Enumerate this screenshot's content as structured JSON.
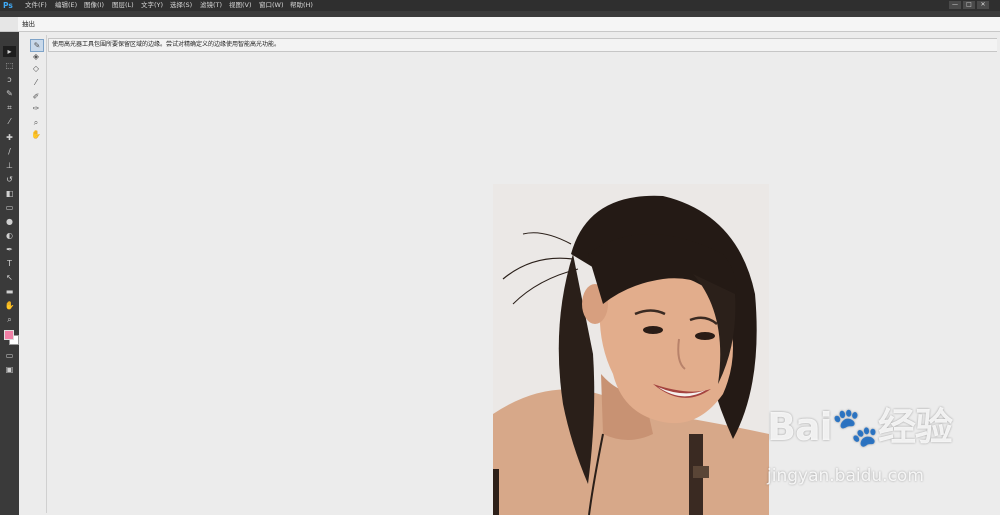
{
  "app": {
    "logo": "Ps"
  },
  "menu": [
    "文件(F)",
    "编辑(E)",
    "图像(I)",
    "图层(L)",
    "文字(Y)",
    "选择(S)",
    "滤镜(T)",
    "视图(V)",
    "窗口(W)",
    "帮助(H)"
  ],
  "window_controls": [
    "—",
    "□",
    "✕"
  ],
  "dialog": {
    "title": "抽出",
    "instruction": "使用高光器工具包围所要保留区域的边缘。尝试对精确定义的边缘使用智能高光功能。"
  },
  "toolbar": {
    "tools": [
      {
        "icon": "move-icon",
        "glyph": "▸"
      },
      {
        "icon": "marquee-icon",
        "glyph": "⬚"
      },
      {
        "icon": "lasso-icon",
        "glyph": "ↄ"
      },
      {
        "icon": "quick-select-icon",
        "glyph": "✎"
      },
      {
        "icon": "crop-icon",
        "glyph": "⌗"
      },
      {
        "icon": "eyedropper-icon",
        "glyph": "⁄"
      },
      {
        "icon": "healing-brush-icon",
        "glyph": "✚"
      },
      {
        "icon": "brush-icon",
        "glyph": "/"
      },
      {
        "icon": "clone-stamp-icon",
        "glyph": "⊥"
      },
      {
        "icon": "history-brush-icon",
        "glyph": "↺"
      },
      {
        "icon": "eraser-icon",
        "glyph": "◧"
      },
      {
        "icon": "gradient-icon",
        "glyph": "▭"
      },
      {
        "icon": "blur-icon",
        "glyph": "●"
      },
      {
        "icon": "dodge-icon",
        "glyph": "◐"
      },
      {
        "icon": "pen-icon",
        "glyph": "✒"
      },
      {
        "icon": "type-icon",
        "glyph": "T"
      },
      {
        "icon": "path-select-icon",
        "glyph": "↖"
      },
      {
        "icon": "rectangle-shape-icon",
        "glyph": "▬"
      },
      {
        "icon": "hand-icon",
        "glyph": "✋"
      },
      {
        "icon": "zoom-icon",
        "glyph": "⌕"
      }
    ],
    "foreground_color": "#f07fa5",
    "background_color": "#ffffff"
  },
  "extract_tools": [
    {
      "icon": "edge-highlighter-icon",
      "glyph": "✎",
      "active": true
    },
    {
      "icon": "fill-icon",
      "glyph": "◈"
    },
    {
      "icon": "eraser-icon",
      "glyph": "◇"
    },
    {
      "icon": "eyedropper-icon",
      "glyph": "⁄"
    },
    {
      "icon": "cleanup-icon",
      "glyph": "✐"
    },
    {
      "icon": "edge-touchup-icon",
      "glyph": "✑"
    },
    {
      "icon": "zoom-icon",
      "glyph": "⌕"
    },
    {
      "icon": "hand-icon",
      "glyph": "✋"
    }
  ],
  "watermark": {
    "logo": "Bai🐾经验",
    "site": "jingyan.baidu.com"
  }
}
